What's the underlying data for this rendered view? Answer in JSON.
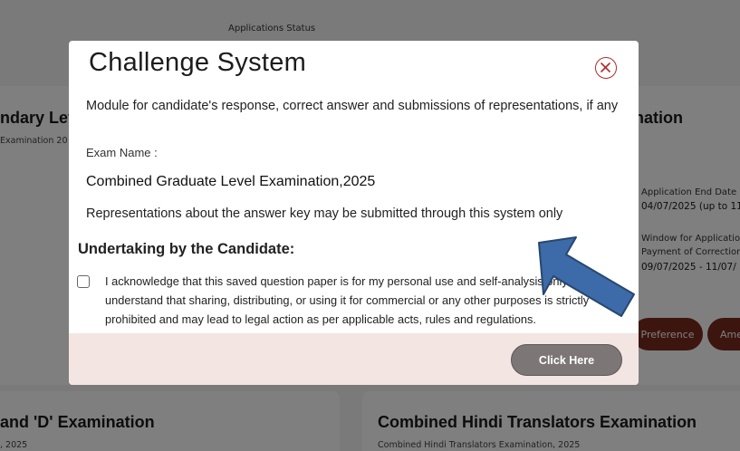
{
  "background": {
    "status_label": "Applications Status",
    "left_card": {
      "heading": "ndary Lev",
      "sub": "Examination 20"
    },
    "right_card": {
      "heading_fragment": "nation",
      "end_date_label": "Application End Date",
      "end_date_value": "04/07/2025 (up to 11",
      "window_label_1": "Window for Applicatio",
      "window_label_2": "Payment of Correction",
      "window_value": "09/07/2025 - 11/07/",
      "preference_button": "Preference",
      "other_button": "Ame"
    },
    "bottom_left": {
      "heading": " and 'D' Examination",
      "sub": ", 2025"
    },
    "bottom_right": {
      "heading": "Combined Hindi Translators Examination",
      "sub": "Combined Hindi Translators Examination, 2025"
    }
  },
  "modal": {
    "title": "Challenge System",
    "close_icon": "close-circle-icon",
    "description": "Module for candidate's response, correct answer and submissions of representations, if any",
    "exam_name_label": "Exam Name :",
    "exam_name_value": "Combined Graduate Level Examination,2025",
    "representations_text": "Representations about the answer key may be submitted through this system only",
    "undertaking_heading": "Undertaking by the Candidate:",
    "acknowledgement": "I acknowledge that this saved question paper is for my personal use and self-analysis only. I understand that sharing, distributing, or using it for commercial or any other purposes is strictly prohibited and may lead to legal action as per applicable acts, rules and regulations.",
    "acknowledgement_checked": false,
    "submit_button": "Click Here"
  },
  "colors": {
    "close_icon": "#b32a2a",
    "footer_bg": "#f3e5e2",
    "button_bg": "#7c7676",
    "arrow_fill": "#3d6aa8",
    "arrow_stroke": "#27476f",
    "pill_bg": "#7a2a1e"
  }
}
